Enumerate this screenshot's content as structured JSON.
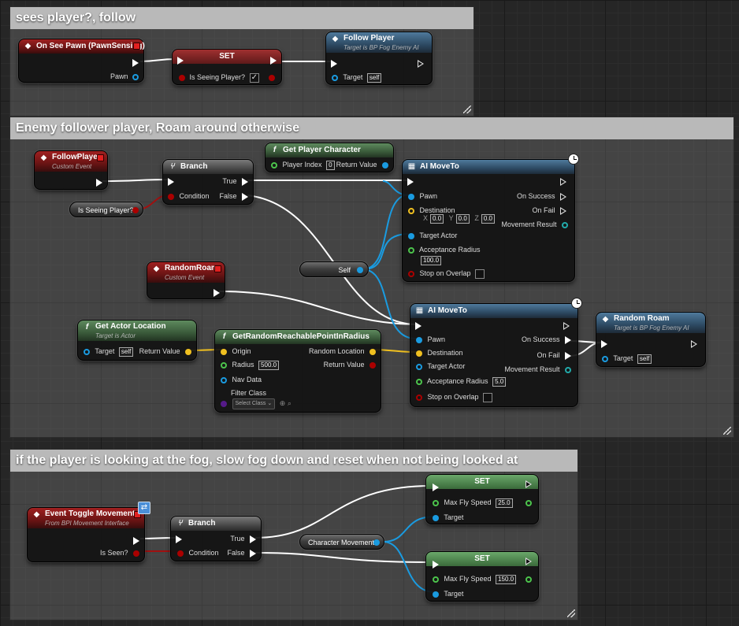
{
  "comments": {
    "c1": "sees player?, follow",
    "c2": "Enemy follower player, Roam around otherwise",
    "c3": "if the player is looking at the fog, slow fog down and reset when not being looked at"
  },
  "nodes": {
    "on_see_pawn": {
      "title": "On See Pawn (PawnSensing)",
      "pawn": "Pawn"
    },
    "set_seeing": {
      "title": "SET",
      "var": "Is Seeing Player?"
    },
    "follow_player_call": {
      "title": "Follow Player",
      "sub": "Target is BP Fog Enemy AI",
      "target": "Target",
      "self": "self"
    },
    "follow_player_event": {
      "title": "FollowPlayer",
      "sub": "Custom Event"
    },
    "is_seeing_var": {
      "label": "Is Seeing Player?"
    },
    "branch1": {
      "title": "Branch",
      "condition": "Condition",
      "true": "True",
      "false": "False"
    },
    "get_player_character": {
      "title": "Get Player Character",
      "player_index": "Player Index",
      "player_index_val": "0",
      "return": "Return Value"
    },
    "ai_moveto1": {
      "title": "AI MoveTo",
      "pawn": "Pawn",
      "destination": "Destination",
      "x": "X",
      "y": "Y",
      "z": "Z",
      "xv": "0.0",
      "yv": "0.0",
      "zv": "0.0",
      "target_actor": "Target Actor",
      "acceptance": "Acceptance Radius",
      "acceptance_val": "100.0",
      "stop": "Stop on Overlap",
      "on_success": "On Success",
      "on_fail": "On Fail",
      "result": "Movement Result"
    },
    "self_var": {
      "label": "Self"
    },
    "random_roam_event": {
      "title": "RandomRoam",
      "sub": "Custom Event"
    },
    "get_actor_location": {
      "title": "Get Actor Location",
      "sub": "Target is Actor",
      "target": "Target",
      "self": "self",
      "return": "Return Value"
    },
    "get_random_point": {
      "title": "GetRandomReachablePointInRadius",
      "origin": "Origin",
      "radius": "Radius",
      "radius_val": "500.0",
      "nav_data": "Nav Data",
      "filter": "Filter Class",
      "select": "Select Class",
      "random_location": "Random Location",
      "return": "Return Value"
    },
    "ai_moveto2": {
      "title": "AI MoveTo",
      "pawn": "Pawn",
      "destination": "Destination",
      "target_actor": "Target Actor",
      "acceptance": "Acceptance Radius",
      "acceptance_val": "5.0",
      "stop": "Stop on Overlap",
      "on_success": "On Success",
      "on_fail": "On Fail",
      "result": "Movement Result"
    },
    "random_roam_call": {
      "title": "Random Roam",
      "sub": "Target is BP Fog Enemy AI",
      "target": "Target",
      "self": "self"
    },
    "toggle_movement": {
      "title": "Event Toggle Movement",
      "sub": "From BPI Movement Interface",
      "is_seen": "Is Seen?"
    },
    "branch2": {
      "title": "Branch",
      "condition": "Condition",
      "true": "True",
      "false": "False"
    },
    "char_movement_var": {
      "label": "Character Movement"
    },
    "set_speed1": {
      "title": "SET",
      "speed": "Max Fly Speed",
      "speed_val": "25.0",
      "target": "Target"
    },
    "set_speed2": {
      "title": "SET",
      "speed": "Max Fly Speed",
      "speed_val": "150.0",
      "target": "Target"
    }
  }
}
